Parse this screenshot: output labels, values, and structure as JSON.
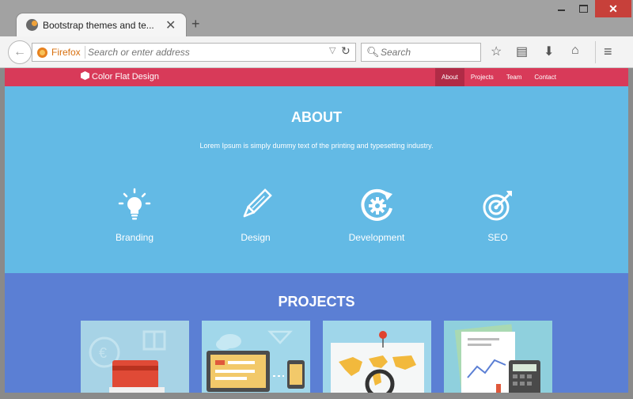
{
  "browser": {
    "tab_title": "Bootstrap themes and te...",
    "urlbar_label": "Firefox",
    "url_placeholder": "Search or enter address",
    "search_placeholder": "Search",
    "window_close_glyph": "✕",
    "tab_close_glyph": "✕",
    "new_tab_glyph": "+"
  },
  "site": {
    "brand": "Color Flat Design",
    "nav": [
      {
        "label": "About",
        "active": true
      },
      {
        "label": "Projects",
        "active": false
      },
      {
        "label": "Team",
        "active": false
      },
      {
        "label": "Contact",
        "active": false
      }
    ],
    "about": {
      "title": "ABOUT",
      "subtitle": "Lorem Ipsum is simply dummy text of the printing and typesetting industry.",
      "services": [
        {
          "label": "Branding",
          "icon": "lightbulb-icon"
        },
        {
          "label": "Design",
          "icon": "pencil-icon"
        },
        {
          "label": "Development",
          "icon": "gear-cycle-icon"
        },
        {
          "label": "SEO",
          "icon": "target-icon"
        }
      ]
    },
    "projects": {
      "title": "PROJECTS",
      "items": [
        {
          "name": "payment-card-illustration"
        },
        {
          "name": "devices-illustration"
        },
        {
          "name": "world-map-search-illustration"
        },
        {
          "name": "finance-calculator-illustration"
        }
      ]
    }
  },
  "colors": {
    "nav": "#d83a59",
    "nav_active": "#b02b46",
    "about_bg": "#63bae5",
    "projects_bg": "#5b7fd4"
  }
}
